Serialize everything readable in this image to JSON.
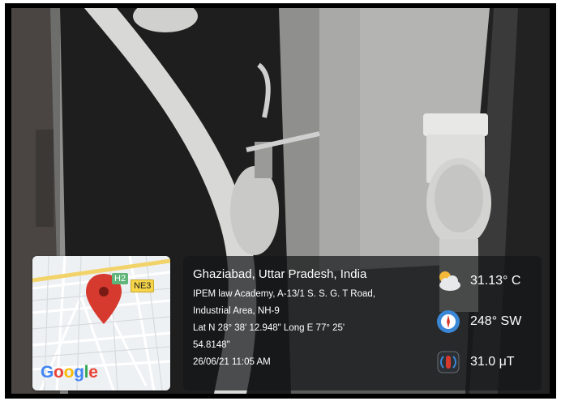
{
  "map": {
    "badges": [
      "H2",
      "NE3"
    ],
    "logo": [
      "G",
      "o",
      "o",
      "g",
      "l",
      "e"
    ]
  },
  "location": {
    "city": "Ghaziabad, Uttar Pradesh, India",
    "address_lines": [
      "IPEM law Academy, A-13/1 S. S. G. T Road,",
      "Industrial Area, NH-9",
      "Lat N 28° 38' 12.948\" Long E 77° 25'",
      "54.8148\"",
      "26/06/21 11:05 AM"
    ]
  },
  "metrics": {
    "temperature": "31.13° C",
    "wind": "248° SW",
    "magnetic": "31.0 μT"
  },
  "icons": {
    "weather": "cloud-sun-icon",
    "wind": "compass-icon",
    "magnetic": "magnet-field-icon"
  }
}
